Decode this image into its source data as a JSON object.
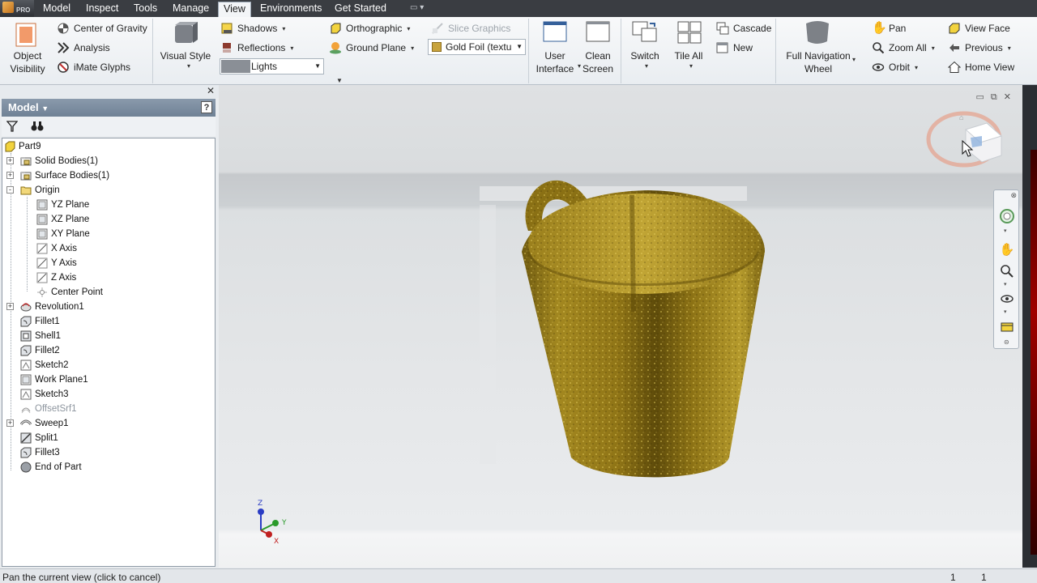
{
  "menu": {
    "app_badge": "PRO",
    "tabs": [
      {
        "label": "Model"
      },
      {
        "label": "Inspect"
      },
      {
        "label": "Tools"
      },
      {
        "label": "Manage"
      },
      {
        "label": "View",
        "active": true
      },
      {
        "label": "Environments"
      },
      {
        "label": "Get Started"
      }
    ]
  },
  "ribbon": {
    "object_visibility": "Object Visibility",
    "center_of_gravity": "Center of Gravity",
    "analysis": "Analysis",
    "imate_glyphs": "iMate Glyphs",
    "visual_style": "Visual Style",
    "shadows": "Shadows",
    "reflections": "Reflections",
    "lights_value": "Lights",
    "orthographic": "Orthographic",
    "ground_plane": "Ground Plane",
    "slice_graphics": "Slice Graphics",
    "appearance_value": "Gold Foil (textu",
    "user_interface": "User Interface",
    "clean_screen": "Clean Screen",
    "switch": "Switch",
    "tile_all": "Tile All",
    "cascade": "Cascade",
    "new": "New",
    "full_navigation_wheel": "Full Navigation Wheel",
    "pan": "Pan",
    "zoom_all": "Zoom All",
    "orbit": "Orbit",
    "view_face": "View Face",
    "previous": "Previous",
    "home_view": "Home View"
  },
  "browser": {
    "title": "Model",
    "help": "?",
    "tree": [
      {
        "label": "Part9",
        "level": 0,
        "expand": "",
        "icon": "part-icon"
      },
      {
        "label": "Solid Bodies(1)",
        "level": 1,
        "expand": "+",
        "icon": "folder-icon"
      },
      {
        "label": "Surface Bodies(1)",
        "level": 1,
        "expand": "+",
        "icon": "folder-icon"
      },
      {
        "label": "Origin",
        "level": 1,
        "expand": "-",
        "icon": "folder-open-icon"
      },
      {
        "label": "YZ Plane",
        "level": 2,
        "expand": "",
        "icon": "plane-icon"
      },
      {
        "label": "XZ Plane",
        "level": 2,
        "expand": "",
        "icon": "plane-icon"
      },
      {
        "label": "XY Plane",
        "level": 2,
        "expand": "",
        "icon": "plane-icon"
      },
      {
        "label": "X Axis",
        "level": 2,
        "expand": "",
        "icon": "axis-icon"
      },
      {
        "label": "Y Axis",
        "level": 2,
        "expand": "",
        "icon": "axis-icon"
      },
      {
        "label": "Z Axis",
        "level": 2,
        "expand": "",
        "icon": "axis-icon"
      },
      {
        "label": "Center Point",
        "level": 2,
        "expand": "",
        "icon": "point-icon"
      },
      {
        "label": "Revolution1",
        "level": 1,
        "expand": "+",
        "icon": "revolve-icon"
      },
      {
        "label": "Fillet1",
        "level": 1,
        "expand": "",
        "icon": "fillet-icon"
      },
      {
        "label": "Shell1",
        "level": 1,
        "expand": "",
        "icon": "shell-icon"
      },
      {
        "label": "Fillet2",
        "level": 1,
        "expand": "",
        "icon": "fillet-icon"
      },
      {
        "label": "Sketch2",
        "level": 1,
        "expand": "",
        "icon": "sketch-icon"
      },
      {
        "label": "Work Plane1",
        "level": 1,
        "expand": "",
        "icon": "plane-icon"
      },
      {
        "label": "Sketch3",
        "level": 1,
        "expand": "",
        "icon": "sketch-icon"
      },
      {
        "label": "OffsetSrf1",
        "level": 1,
        "expand": "",
        "icon": "offset-surface-icon",
        "suppressed": true
      },
      {
        "label": "Sweep1",
        "level": 1,
        "expand": "+",
        "icon": "sweep-icon"
      },
      {
        "label": "Split1",
        "level": 1,
        "expand": "",
        "icon": "split-icon"
      },
      {
        "label": "Fillet3",
        "level": 1,
        "expand": "",
        "icon": "fillet-icon"
      },
      {
        "label": "End of Part",
        "level": 1,
        "expand": "",
        "icon": "end-of-part-icon"
      }
    ]
  },
  "triad": {
    "x": "X",
    "y": "Y",
    "z": "Z"
  },
  "status": {
    "text": "Pan the current view (click to cancel)",
    "count1": "1",
    "count2": "1"
  },
  "colors": {
    "gold": "#9a7d18",
    "accent": "#6f8195",
    "menubar": "#3a3d42"
  }
}
